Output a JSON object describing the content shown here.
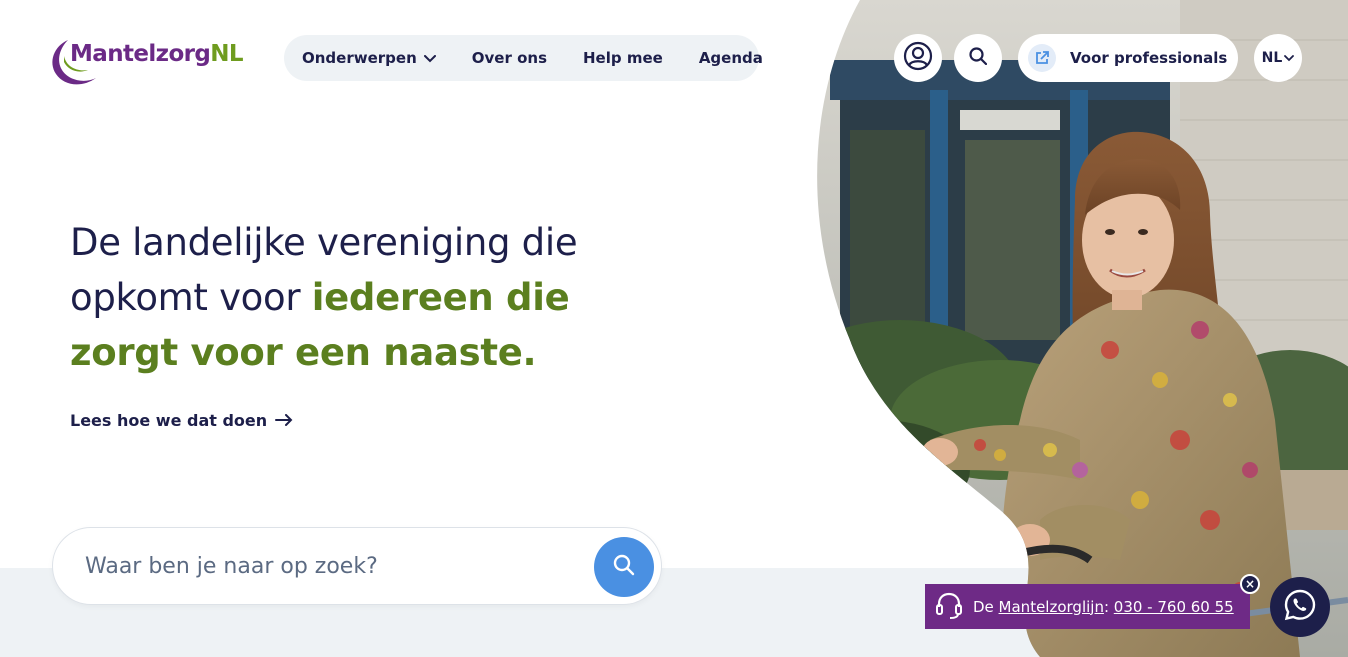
{
  "logo": {
    "prefix": "Mantelzorg",
    "suffix": "NL"
  },
  "nav": {
    "items": [
      {
        "label": "Onderwerpen",
        "has_dropdown": true
      },
      {
        "label": "Over ons"
      },
      {
        "label": "Help mee"
      },
      {
        "label": "Agenda"
      }
    ]
  },
  "header_actions": {
    "account_icon": "user-circle-icon",
    "search_icon": "search-icon",
    "professionals_label": "Voor professionals",
    "professionals_icon": "external-link-icon",
    "language": "NL"
  },
  "hero": {
    "headline_part1": "De landelijke vereniging die opkomt voor ",
    "headline_highlight": "iedereen die zorgt voor een naaste.",
    "read_more": "Lees hoe we dat doen",
    "read_more_icon": "arrow-right-icon"
  },
  "search": {
    "placeholder": "Waar ben je naar op zoek?"
  },
  "helpline": {
    "prefix": "De ",
    "name": "Mantelzorglijn",
    "separator": ": ",
    "phone": "030 - 760 60 55",
    "close_label": "×"
  },
  "colors": {
    "navy": "#1d1f4a",
    "green": "#5b7f1f",
    "purple": "#6e2a86",
    "blue": "#4a90e2",
    "grey_band": "#eef2f5"
  }
}
